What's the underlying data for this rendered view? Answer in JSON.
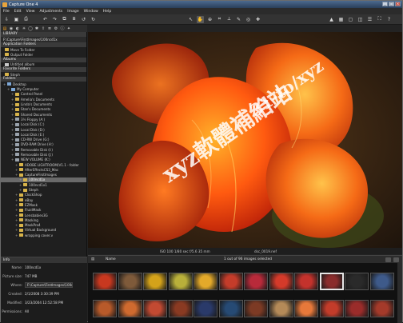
{
  "window": {
    "title": "Capture One 4"
  },
  "menu": [
    "File",
    "Edit",
    "View",
    "Adjustments",
    "Image",
    "Window",
    "Help"
  ],
  "panels": {
    "library": "LIBRARY",
    "path": "F:\\Capture\\FirstImages\\100ncd1x",
    "app_folders_hdr": "Application Folders",
    "app_folders": [
      "Move To Folder",
      "Output Folder"
    ],
    "albums_hdr": "Albums",
    "albums": [
      "Untitled album"
    ],
    "favorites_hdr": "Favorite Folders",
    "favorites": [
      "Steph"
    ],
    "folders_hdr": "Folders",
    "folders": [
      {
        "label": "Desktop",
        "level": 0,
        "icon": "pc"
      },
      {
        "label": "My Computer",
        "level": 1,
        "icon": "pc"
      },
      {
        "label": "Control Panel",
        "level": 2,
        "icon": "folder"
      },
      {
        "label": "Amelia's Documents",
        "level": 2,
        "icon": "folder"
      },
      {
        "label": "Linda's Documents",
        "level": 2,
        "icon": "folder"
      },
      {
        "label": "Stan's Documents",
        "level": 2,
        "icon": "folder"
      },
      {
        "label": "Shared Documents",
        "level": 2,
        "icon": "folder"
      },
      {
        "label": "3½ Floppy (A:)",
        "level": 2,
        "icon": "drive"
      },
      {
        "label": "Local Disk (C:)",
        "level": 2,
        "icon": "drive"
      },
      {
        "label": "Local Disk (D:)",
        "level": 2,
        "icon": "drive"
      },
      {
        "label": "Local Disk (E:)",
        "level": 2,
        "icon": "drive"
      },
      {
        "label": "CD-RW Drive (G:)",
        "level": 2,
        "icon": "drive"
      },
      {
        "label": "DVD-RAM Drive (H:)",
        "level": 2,
        "icon": "drive"
      },
      {
        "label": "Removable Disk (I:)",
        "level": 2,
        "icon": "drive"
      },
      {
        "label": "Removable Disk (J:)",
        "level": 2,
        "icon": "drive"
      },
      {
        "label": "NEW VOLUME (K:)",
        "level": 2,
        "icon": "drive"
      },
      {
        "label": "ADOBE LIGHTROOM(V1.1 - folder",
        "level": 3,
        "icon": "folder"
      },
      {
        "label": "AfterEffectsCS3_Mac",
        "level": 3,
        "icon": "folder"
      },
      {
        "label": "CaptureFirstImages",
        "level": 3,
        "icon": "folder"
      },
      {
        "label": "100ncd1x",
        "level": 4,
        "icon": "folder",
        "state": "sel"
      },
      {
        "label": "100ncd1x1",
        "level": 4,
        "icon": "folder"
      },
      {
        "label": "Steph",
        "level": 4,
        "icon": "folder"
      },
      {
        "label": "ClockShop",
        "level": 3,
        "icon": "folder"
      },
      {
        "label": "eBay",
        "level": 3,
        "icon": "folder"
      },
      {
        "label": "EZMask",
        "level": 3,
        "icon": "folder"
      },
      {
        "label": "FluidMask",
        "level": 3,
        "icon": "folder"
      },
      {
        "label": "Lensbabies3G",
        "level": 3,
        "icon": "folder"
      },
      {
        "label": "Masking",
        "level": 3,
        "icon": "folder"
      },
      {
        "label": "MaskPro4",
        "level": 3,
        "icon": "folder"
      },
      {
        "label": "Virtual Background",
        "level": 3,
        "icon": "folder"
      },
      {
        "label": "wrapping cover.v",
        "level": 3,
        "icon": "folder"
      }
    ]
  },
  "info": {
    "header": "Info",
    "name_label": "Name:",
    "name": "100ncd1x",
    "size_label": "Picture size:",
    "size": "747 MB",
    "where_label": "Where:",
    "where": "F:\\Capture\\FirstImages\\100ncd1x",
    "created_label": "Created:",
    "created": "2/1/2008 3:30:39 PM",
    "modified_label": "Modified:",
    "modified": "3/23/2004 12:52:58 PM",
    "permissions_label": "Permissions:",
    "permissions": "All"
  },
  "viewer": {
    "exposure": "ISO 100  1/80 sec  f/5.6  35 mm",
    "filename": "dsc_0019.nef",
    "watermark_1": "xyz軟體補給站",
    "watermark_2": "31-to/xyz"
  },
  "browser": {
    "sort_label": "Name",
    "count": "1 out of 96 images selected"
  },
  "thumb_colors": [
    "#c8381f",
    "#7e5a3a",
    "#d4a21a",
    "#b9b03a",
    "#e3a92a",
    "#c43c2a",
    "#b82a3a",
    "#d43a2a",
    "#c4322c",
    "#8a2c2c",
    "#2a2a2a",
    "#3e5a8a",
    "#b85a2a",
    "#cf6a2f",
    "#c24a32",
    "#8a3a22",
    "#2a3a6a",
    "#264a74",
    "#7c3a24",
    "#b48a58",
    "#e6783a",
    "#c33c2a",
    "#9a2c2a",
    "#a43a2a"
  ],
  "accent": "#f0a020"
}
